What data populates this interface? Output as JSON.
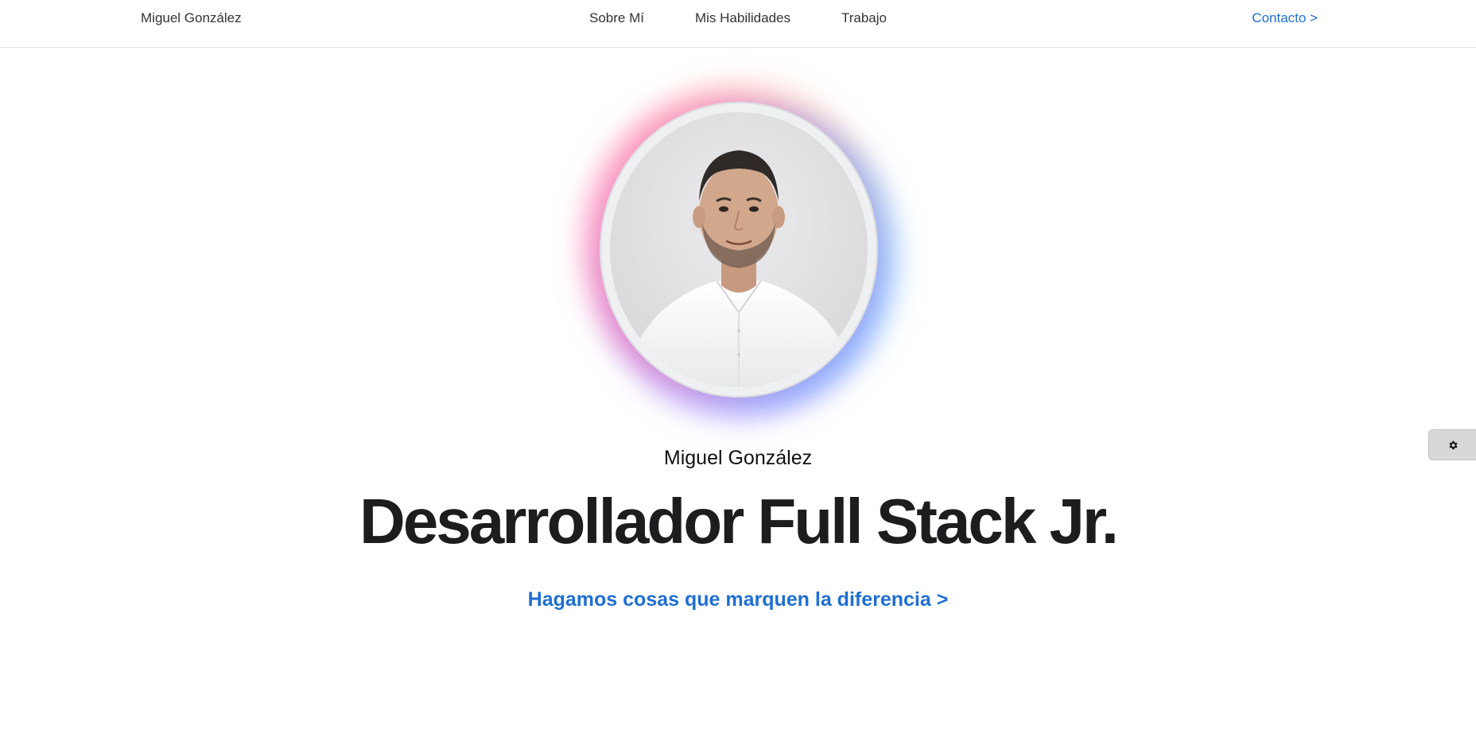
{
  "header": {
    "brand": "Miguel González",
    "nav": [
      "Sobre Mí",
      "Mis Habilidades",
      "Trabajo"
    ],
    "contact": "Contacto >"
  },
  "hero": {
    "photo_alt": "Miguel González",
    "name": "Miguel González",
    "title": "Desarrollador Full Stack Jr.",
    "cta": "Hagamos cosas que marquen la diferencia >"
  },
  "settings": {
    "icon": "gear-icon"
  },
  "colors": {
    "accent": "#1f6fd2",
    "text": "#1d1d1f",
    "glow_pink": "#ff68aa",
    "glow_blue": "#5daaff",
    "glow_purple": "#966eff"
  }
}
